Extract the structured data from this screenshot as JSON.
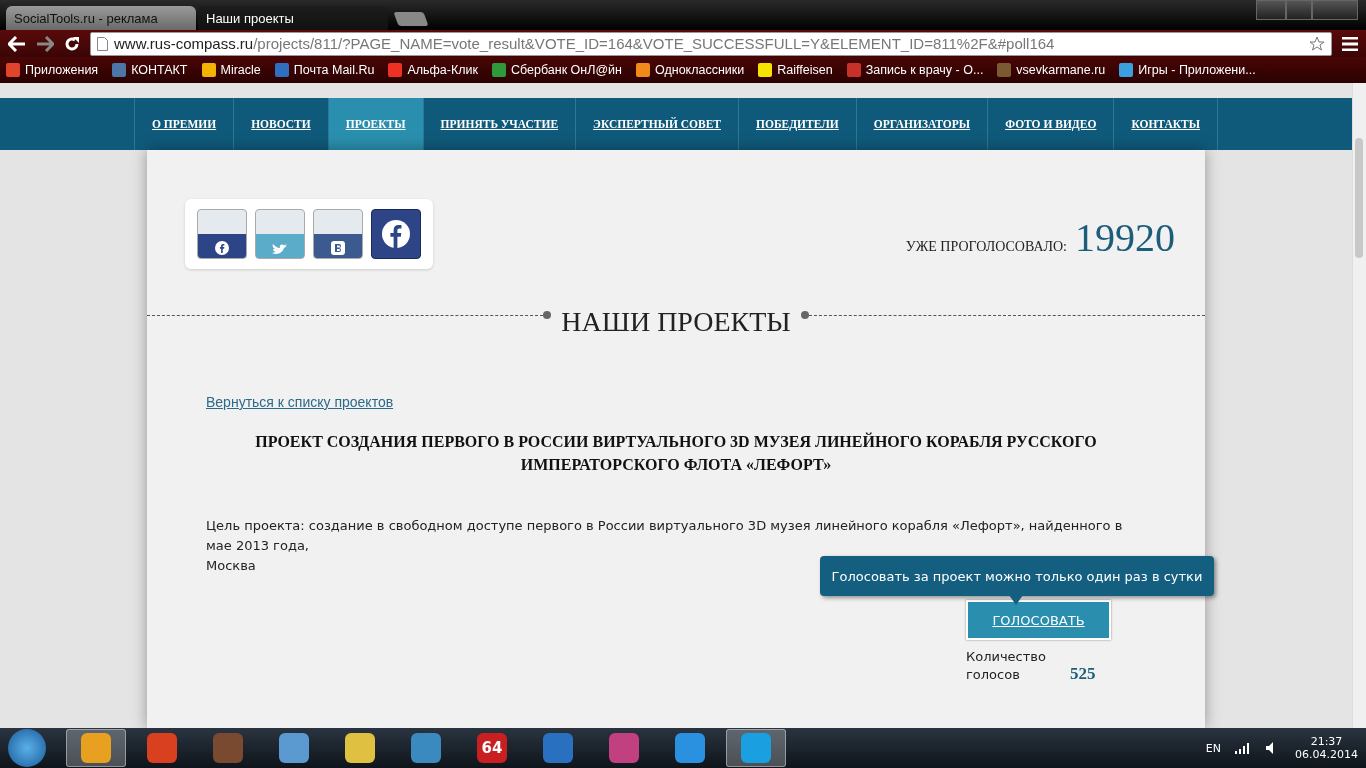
{
  "browser": {
    "tabs": [
      {
        "label": "SocialTools.ru - реклама",
        "selected": false
      },
      {
        "label": "Наши проекты",
        "selected": true
      }
    ],
    "url": {
      "host": "www.rus-compass.ru",
      "path": "/projects/811/?PAGE_NAME=vote_result&VOTE_ID=164&VOTE_SUCCESSFULL=Y&ELEMENT_ID=811%2F&#poll164"
    },
    "bookmarks": [
      {
        "label": "Приложения",
        "color": "#e0452c"
      },
      {
        "label": "КОНТАКТ",
        "color": "#4a76a8"
      },
      {
        "label": "Miracle",
        "color": "#f2b400"
      },
      {
        "label": "Почта Mail.Ru",
        "color": "#2f6fbf"
      },
      {
        "label": "Альфа-Клик",
        "color": "#ef3124"
      },
      {
        "label": "Сбербанк ОнЛ@йн",
        "color": "#2f9a3a"
      },
      {
        "label": "Одноклассники",
        "color": "#f28a1a"
      },
      {
        "label": "Raiffeisen",
        "color": "#f5e400"
      },
      {
        "label": "Запись к врачу - О...",
        "color": "#c8302a"
      },
      {
        "label": "vsevkarmane.ru",
        "color": "#7a5a30"
      },
      {
        "label": "Игры - Приложени...",
        "color": "#3aa0e0"
      }
    ]
  },
  "nav": [
    {
      "label": "О ПРЕМИИ",
      "selected": false
    },
    {
      "label": "НОВОСТИ",
      "selected": false
    },
    {
      "label": "ПРОЕКТЫ",
      "selected": true
    },
    {
      "label": "ПРИНЯТЬ УЧАСТИЕ",
      "selected": false
    },
    {
      "label": "ЭКСПЕРТНЫЙ СОВЕТ",
      "selected": false
    },
    {
      "label": "ПОБЕДИТЕЛИ",
      "selected": false
    },
    {
      "label": "ОРГАНИЗАТОРЫ",
      "selected": false
    },
    {
      "label": "ФОТО И ВИДЕО",
      "selected": false
    },
    {
      "label": "КОНТАКТЫ",
      "selected": false
    }
  ],
  "social": [
    {
      "kind": "facebook"
    },
    {
      "kind": "twitter"
    },
    {
      "kind": "vk"
    },
    {
      "kind": "facebook-big"
    }
  ],
  "counter": {
    "label": "УЖЕ ПРОГОЛОСОВАЛО:",
    "value": "19920"
  },
  "section_title": "НАШИ ПРОЕКТЫ",
  "back_link": "Вернуться к списку проектов",
  "project": {
    "title": "ПРОЕКТ СОЗДАНИЯ ПЕРВОГО В РОССИИ ВИРТУАЛЬНОГО 3D МУЗЕЯ ЛИНЕЙНОГО КОРАБЛЯ РУССКОГО ИМПЕРАТОРСКОГО ФЛОТА «ЛЕФОРТ»",
    "description": [
      "Цель проекта: создание в свободном доступе первого в России виртуального 3D музея линейного корабля «Лефорт», найденного в мае 2013 года,",
      "Москва"
    ],
    "tooltip": "Голосовать за проект можно только один раз в сутки",
    "vote_button": "ГОЛОСОВАТЬ",
    "votes_label": "Количество голосов",
    "votes": "525"
  },
  "taskbar": {
    "apps": [
      {
        "color": "#e8a020",
        "active": true
      },
      {
        "color": "#d84020",
        "active": false
      },
      {
        "color": "#7a4a30",
        "active": false
      },
      {
        "color": "#5a9ad0",
        "active": false
      },
      {
        "color": "#e0c040",
        "active": false
      },
      {
        "color": "#3a8ac0",
        "active": false
      },
      {
        "color": "#c82020",
        "label": "64",
        "active": false
      },
      {
        "color": "#2a70c0",
        "active": false
      },
      {
        "color": "#c04080",
        "active": false
      },
      {
        "color": "#2a90e0",
        "active": false
      },
      {
        "color": "#1aa0e0",
        "active": true
      }
    ],
    "lang": "EN",
    "time": "21:37",
    "date": "06.04.2014"
  }
}
